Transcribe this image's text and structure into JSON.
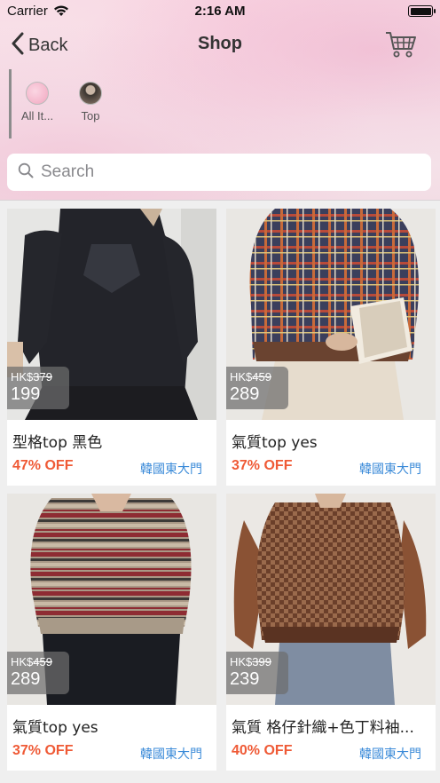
{
  "status_bar": {
    "carrier": "Carrier",
    "time": "2:16 AM"
  },
  "nav": {
    "back_label": "Back",
    "title": "Shop"
  },
  "categories": [
    {
      "label": "All It..."
    },
    {
      "label": "Top"
    }
  ],
  "search": {
    "placeholder": "Search"
  },
  "products": [
    {
      "currency": "HK$",
      "old_price": "379",
      "price": "199",
      "name": "型格top 黑色",
      "discount": "47% OFF",
      "store": "韓國東大門"
    },
    {
      "currency": "HK$",
      "old_price": "459",
      "price": "289",
      "name": "氣質top yes",
      "discount": "37% OFF",
      "store": "韓國東大門"
    },
    {
      "currency": "HK$",
      "old_price": "459",
      "price": "289",
      "name": "氣質top yes",
      "discount": "37% OFF",
      "store": "韓國東大門"
    },
    {
      "currency": "HK$",
      "old_price": "399",
      "price": "239",
      "name": "氣質 格仔針織+色丁料袖...",
      "discount": "40% OFF",
      "store": "韓國東大門"
    }
  ],
  "colors": {
    "discount": "#ef5a36",
    "store": "#3a8ad8",
    "header": "#f6e0e8"
  }
}
